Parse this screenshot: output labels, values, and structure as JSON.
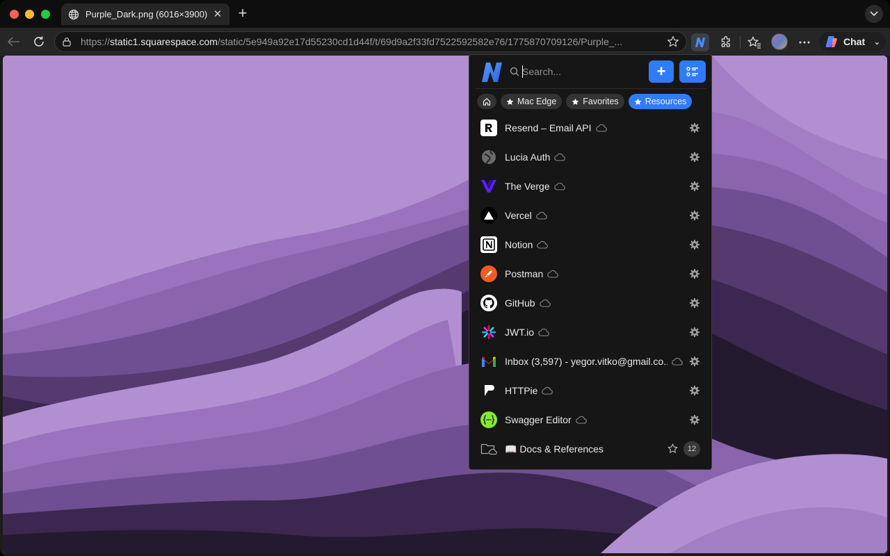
{
  "browser": {
    "tab_title": "Purple_Dark.png (6016×3900)",
    "url_domain": "static1.squarespace.com",
    "url_path": "/static/5e949a92e17d55230cd1d44f/t/69d9a2f33fd7522592582e76/1775870709126/Purple_...",
    "url_scheme": "https://",
    "chat_label": "Chat"
  },
  "popup": {
    "search_placeholder": "Search...",
    "chips": [
      {
        "label": "Mac Edge",
        "active": false
      },
      {
        "label": "Favorites",
        "active": false
      },
      {
        "label": "Resources",
        "active": true
      }
    ],
    "items": [
      {
        "label": "Resend – Email API",
        "icon": "resend-icon"
      },
      {
        "label": "Lucia Auth",
        "icon": "lucia-icon"
      },
      {
        "label": "The Verge",
        "icon": "verge-icon"
      },
      {
        "label": "Vercel",
        "icon": "vercel-icon"
      },
      {
        "label": "Notion",
        "icon": "notion-icon"
      },
      {
        "label": "Postman",
        "icon": "postman-icon"
      },
      {
        "label": "GitHub",
        "icon": "github-icon"
      },
      {
        "label": "JWT.io",
        "icon": "jwt-icon"
      },
      {
        "label": "Inbox (3,597) - yegor.vitko@gmail.co...",
        "icon": "gmail-icon"
      },
      {
        "label": "HTTPie",
        "icon": "httpie-icon"
      },
      {
        "label": "Swagger Editor",
        "icon": "swagger-icon"
      }
    ],
    "folder": {
      "label": "📖 Docs & References",
      "count": "12"
    }
  },
  "colors": {
    "accent": "#2f7cf6",
    "wallpaper_light": "#b28fd0",
    "wallpaper_dark": "#1c1420"
  }
}
